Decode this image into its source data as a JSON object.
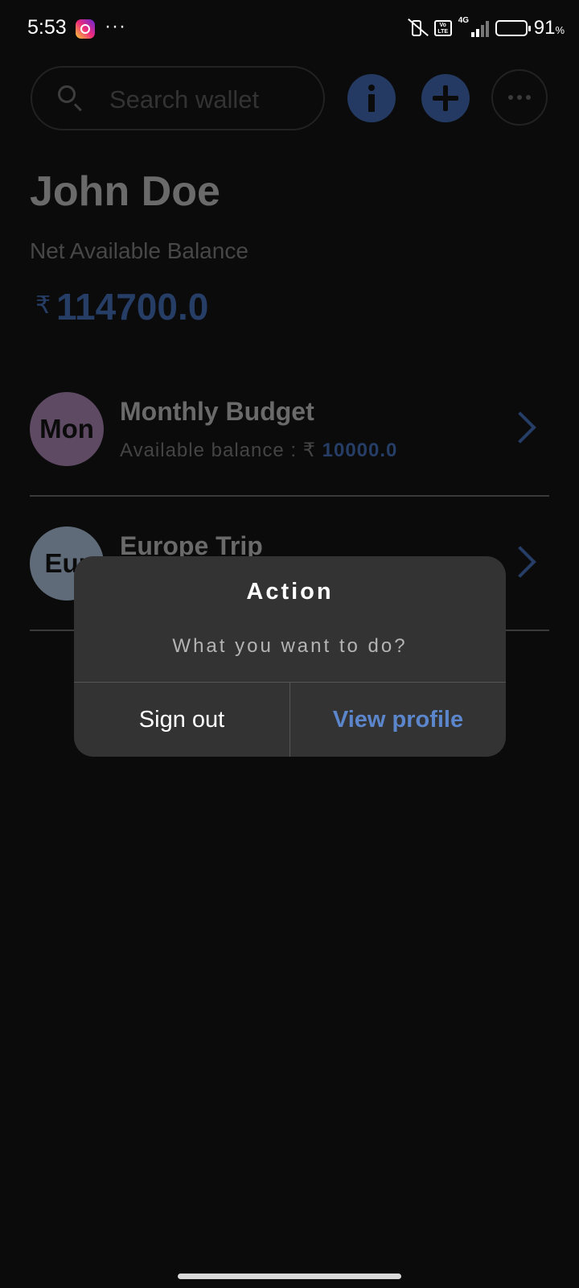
{
  "status_bar": {
    "time": "5:53",
    "network": "4G",
    "volte": "Vo\nLTE",
    "battery_percent": "91",
    "battery_unit": "%",
    "overflow": "···"
  },
  "header": {
    "search_placeholder": "Search wallet"
  },
  "user": {
    "name": "John Doe",
    "balance_label": "Net Available Balance",
    "currency": "₹",
    "balance": "114700.0"
  },
  "wallets": [
    {
      "avatar_text": "Mon",
      "avatar_color": "#5e4a62",
      "title": "Monthly Budget",
      "sub_label": "Available balance : ₹ ",
      "amount": "10000.0"
    },
    {
      "avatar_text": "Eur",
      "avatar_color": "#5f6b78",
      "title": "Europe Trip",
      "sub_label": "",
      "amount": ""
    }
  ],
  "dialog": {
    "title": "Action",
    "message": "What you want to do?",
    "negative": "Sign out",
    "positive": "View profile"
  },
  "colors": {
    "accent": "#5b86cc",
    "dim_accent": "#263d66",
    "dialog_bg": "#333334"
  }
}
